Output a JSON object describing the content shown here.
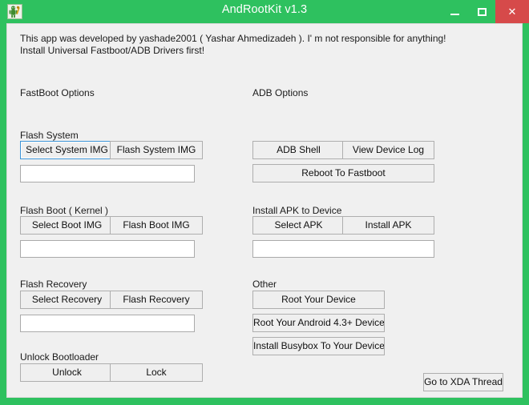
{
  "window": {
    "title": "AndRootKit v1.3",
    "icon": "android-robot-wrench-icon",
    "accent_color": "#2ec15f",
    "close_button_color": "#d64a4a",
    "client_background": "#f0f0f0",
    "controls": {
      "minimize_label": "–",
      "maximize_label": "□",
      "close_label": "✕"
    }
  },
  "notice": "This app was developed by yashade2001 ( Yashar Ahmedizadeh ). I' m not responsible for anything!\nInstall Universal Fastboot/ADB Drivers first!",
  "columns": {
    "fastboot": {
      "title": "FastBoot Options",
      "groups": [
        {
          "label": "Flash System",
          "buttons": [
            "Select System IMG",
            "Flash System IMG"
          ],
          "textbox": {
            "value": "",
            "placeholder": ""
          }
        },
        {
          "label": "Flash Boot ( Kernel )",
          "buttons": [
            "Select Boot IMG",
            "Flash Boot IMG"
          ],
          "textbox": {
            "value": "",
            "placeholder": ""
          }
        },
        {
          "label": "Flash Recovery",
          "buttons": [
            "Select Recovery",
            "Flash Recovery"
          ],
          "textbox": {
            "value": "",
            "placeholder": ""
          }
        },
        {
          "label": "Unlock Bootloader",
          "buttons": [
            "Unlock",
            "Lock"
          ]
        }
      ]
    },
    "adb": {
      "title": "ADB Options",
      "groups": [
        {
          "label": "",
          "buttons": [
            "ADB Shell",
            "View Device Log",
            "Reboot To Fastboot"
          ]
        },
        {
          "label": "Install APK to Device",
          "buttons": [
            "Select APK",
            "Install APK"
          ],
          "textbox": {
            "value": "",
            "placeholder": ""
          }
        },
        {
          "label": "Other",
          "buttons": [
            "Root Your Device",
            "Root Your Android 4.3+ Device",
            "Install Busybox To Your Device"
          ]
        }
      ]
    }
  },
  "footer": {
    "xda_button": "Go to XDA Thread"
  }
}
